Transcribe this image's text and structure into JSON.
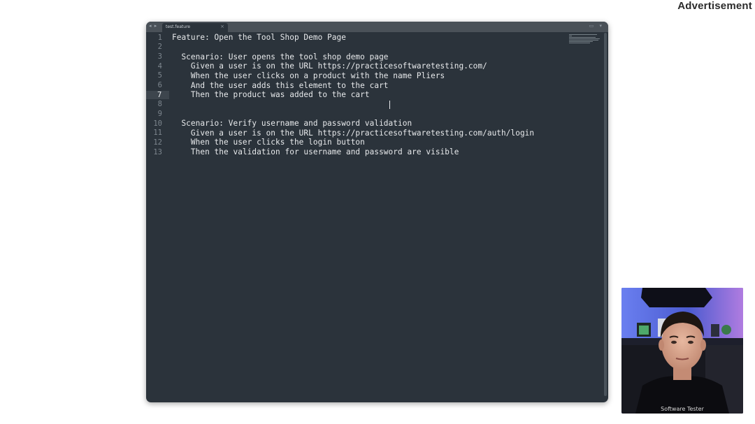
{
  "advertisement_label": "Advertisement",
  "editor": {
    "nav_arrows": "◂ ▸",
    "tab": {
      "title": "test.feature",
      "close_glyph": "×"
    },
    "tab_bar_right_glyphs": "▭ ▾",
    "active_line": 7,
    "lines": [
      {
        "number": "1",
        "text": "Feature: Open the Tool Shop Demo Page"
      },
      {
        "number": "2",
        "text": ""
      },
      {
        "number": "3",
        "text": "  Scenario: User opens the tool shop demo page"
      },
      {
        "number": "4",
        "text": "    Given a user is on the URL https://practicesoftwaretesting.com/"
      },
      {
        "number": "5",
        "text": "    When the user clicks on a product with the name Pliers"
      },
      {
        "number": "6",
        "text": "    And the user adds this element to the cart"
      },
      {
        "number": "7",
        "text": "    Then the product was added to the cart"
      },
      {
        "number": "8",
        "text": ""
      },
      {
        "number": "9",
        "text": ""
      },
      {
        "number": "10",
        "text": "  Scenario: Verify username and password validation"
      },
      {
        "number": "11",
        "text": "    Given a user is on the URL https://practicesoftwaretesting.com/auth/login"
      },
      {
        "number": "12",
        "text": "    When the user clicks the login button"
      },
      {
        "number": "13",
        "text": "    Then the validation for username and password are visible"
      }
    ]
  },
  "colors": {
    "editor_background": "#2b333b",
    "tab_bar": "#4a5158",
    "code_text": "#e8eaec",
    "line_number": "#7d868e",
    "webcam_wall": "#5a6fd6"
  },
  "webcam": {
    "shirt_text": "Software Tester"
  }
}
